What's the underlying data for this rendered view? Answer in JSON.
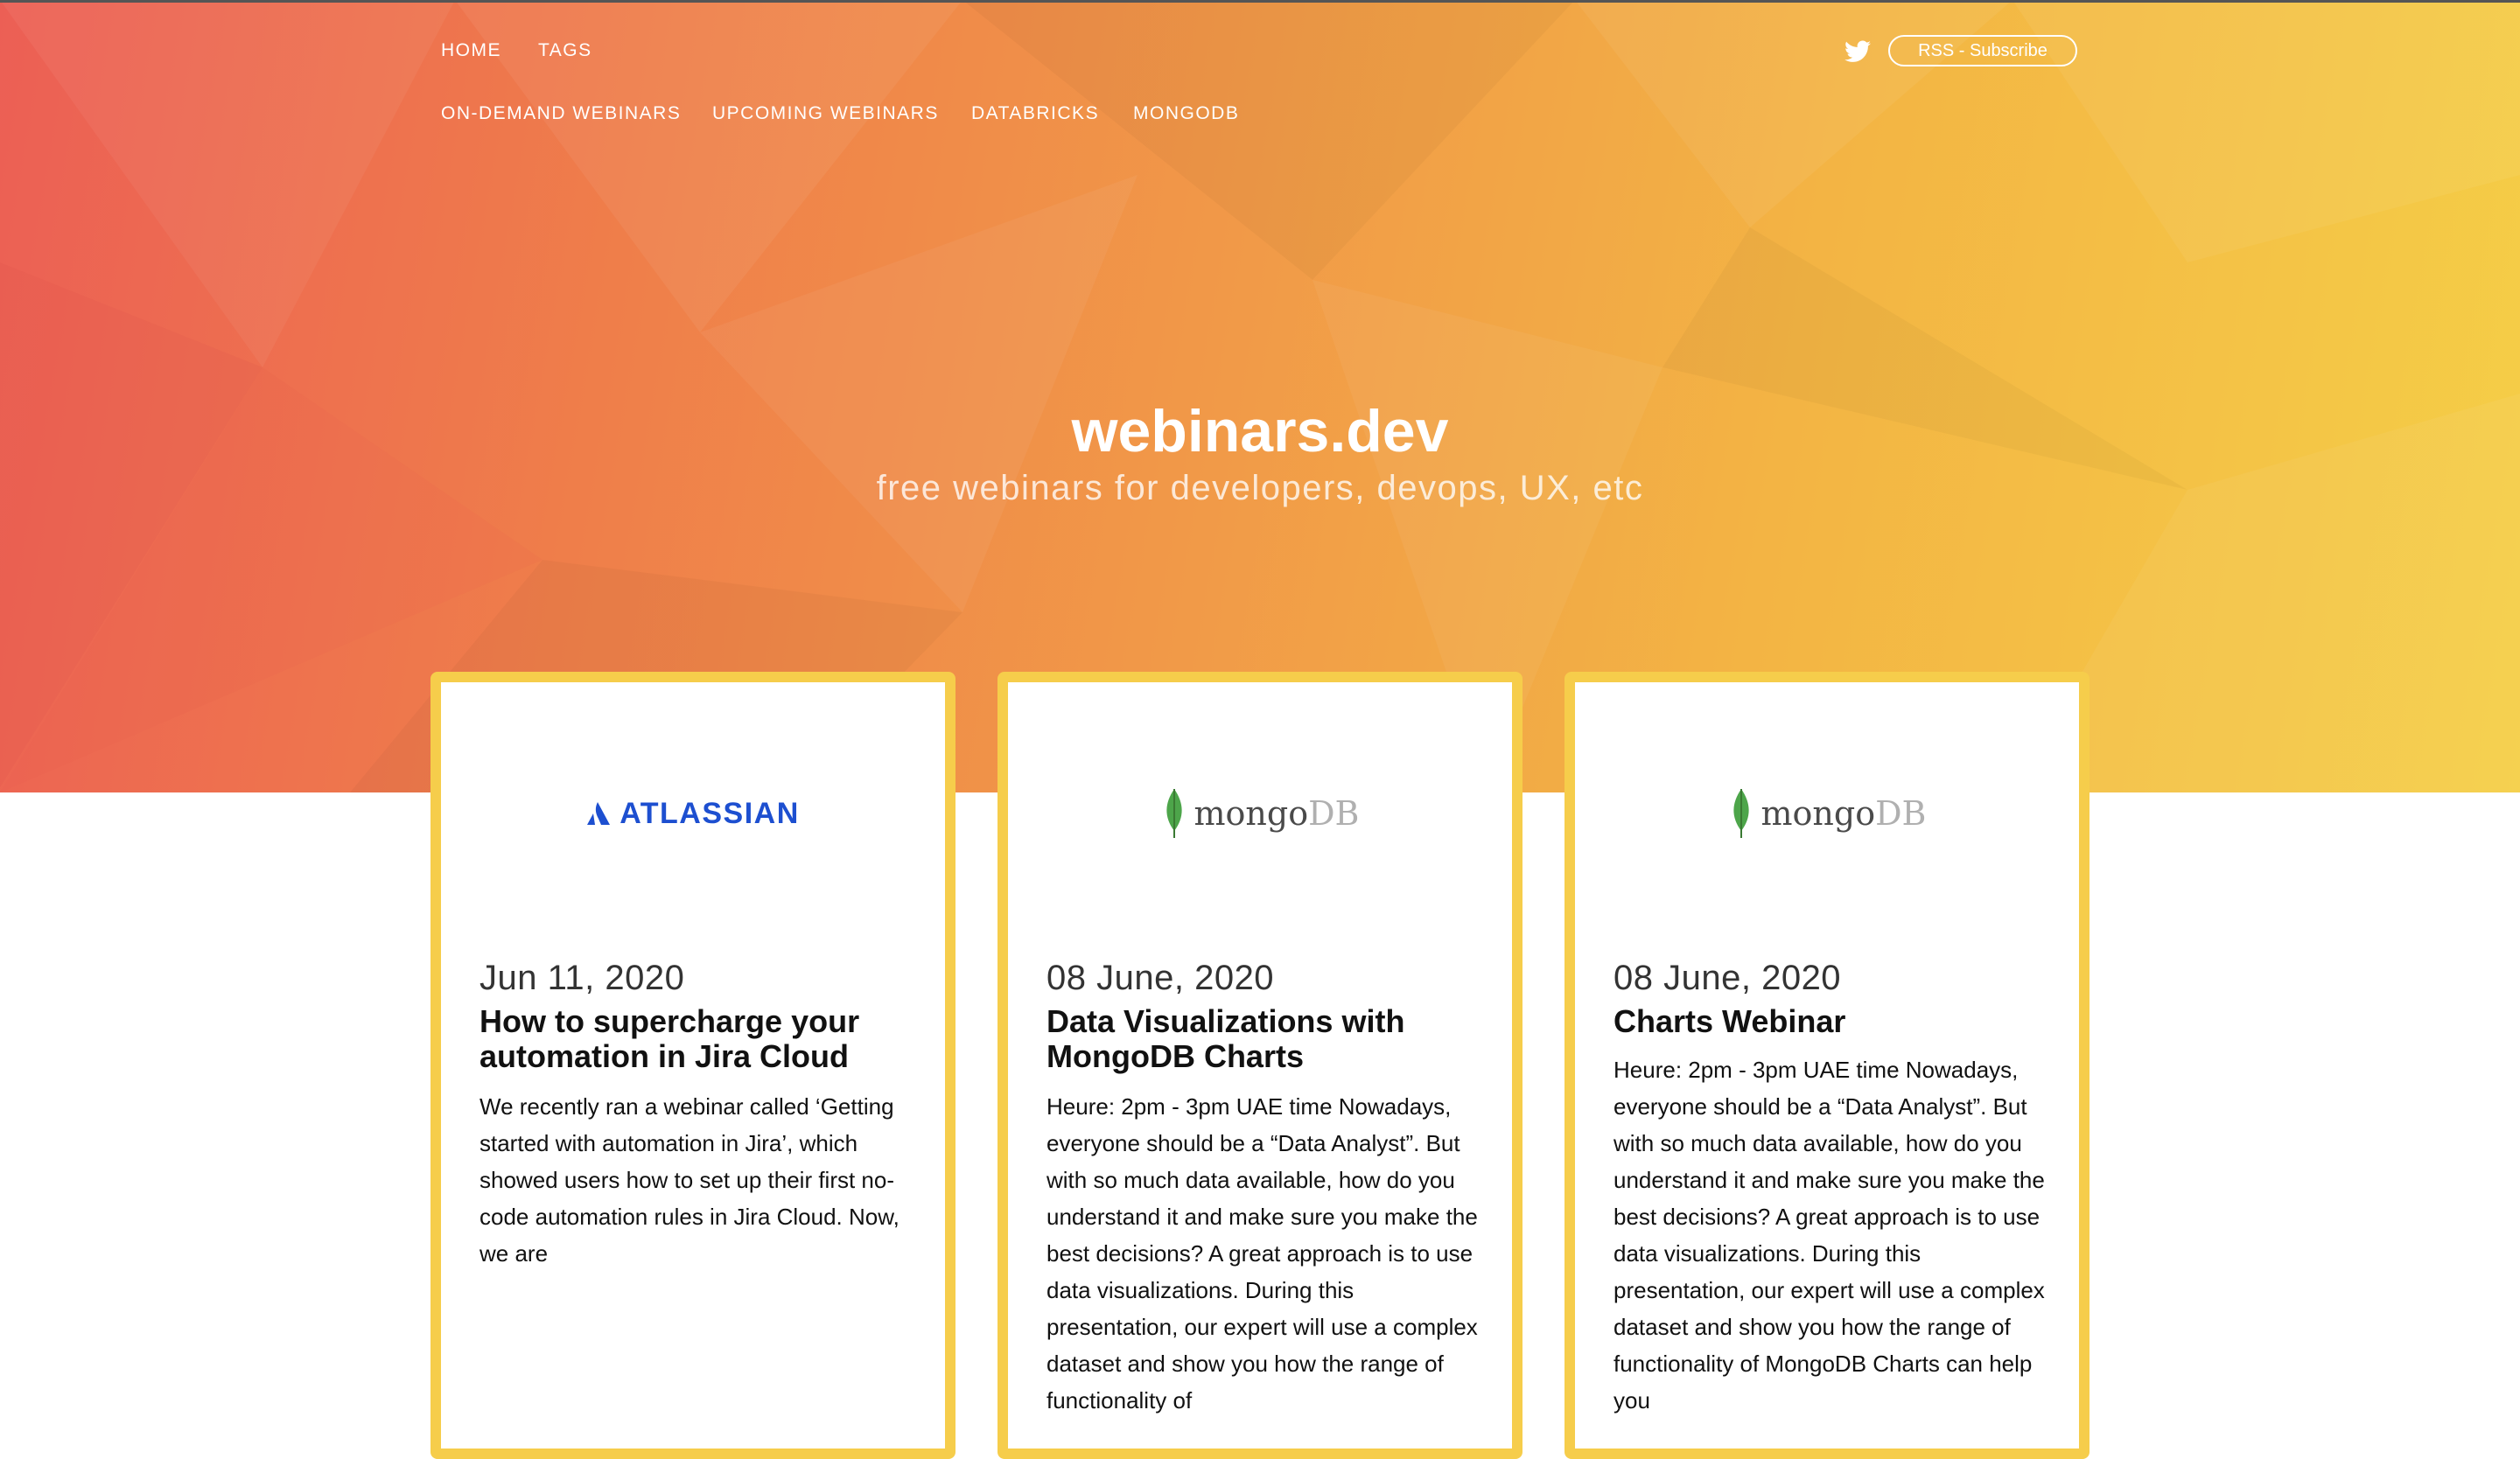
{
  "nav": {
    "home": "HOME",
    "tags": "TAGS",
    "on_demand": "ON-DEMAND WEBINARS",
    "upcoming": "UPCOMING WEBINARS",
    "databricks": "DATABRICKS",
    "mongodb": "MONGODB",
    "rss": "RSS - Subscribe"
  },
  "header": {
    "title": "webinars.dev",
    "subtitle": "free webinars for developers, devops, UX, etc"
  },
  "colors": {
    "hero_start": "#ec5f55",
    "hero_end": "#f5cf47",
    "card_border": "#f6cd4b",
    "atlassian_blue": "#1d4fd0",
    "mongo_green": "#4da54a"
  },
  "cards": [
    {
      "logo": {
        "brand": "ATLASSIAN",
        "icon": "atlassian-logo-icon"
      },
      "date": "Jun 11, 2020",
      "title": "How to supercharge your automation in Jira Cloud",
      "desc": "We recently ran a webinar called ‘Getting started with automation in Jira’, which showed users how to set up their first no-code automation rules in Jira Cloud. Now, we are"
    },
    {
      "logo": {
        "brand_main": "mongo",
        "brand_db": "DB",
        "icon": "mongodb-leaf-icon"
      },
      "date": "08 June, 2020",
      "title": "Data Visualizations with MongoDB Charts",
      "desc": "Heure: 2pm - 3pm UAE time Nowadays, everyone should be a “Data Analyst”. But with so much data available, how do you understand it and make sure you make the best decisions? A great approach is to use data visualizations. During this presentation, our expert will use a complex dataset and show you how the range of functionality of"
    },
    {
      "logo": {
        "brand_main": "mongo",
        "brand_db": "DB",
        "icon": "mongodb-leaf-icon"
      },
      "date": "08 June, 2020",
      "title": "Charts Webinar",
      "desc": "Heure: 2pm - 3pm UAE time Nowadays, everyone should be a “Data Analyst”. But with so much data available, how do you understand it and make sure you make the best decisions? A great approach is to use data visualizations. During this presentation, our expert will use a complex dataset and show you how the range of functionality of MongoDB Charts can help you"
    }
  ]
}
